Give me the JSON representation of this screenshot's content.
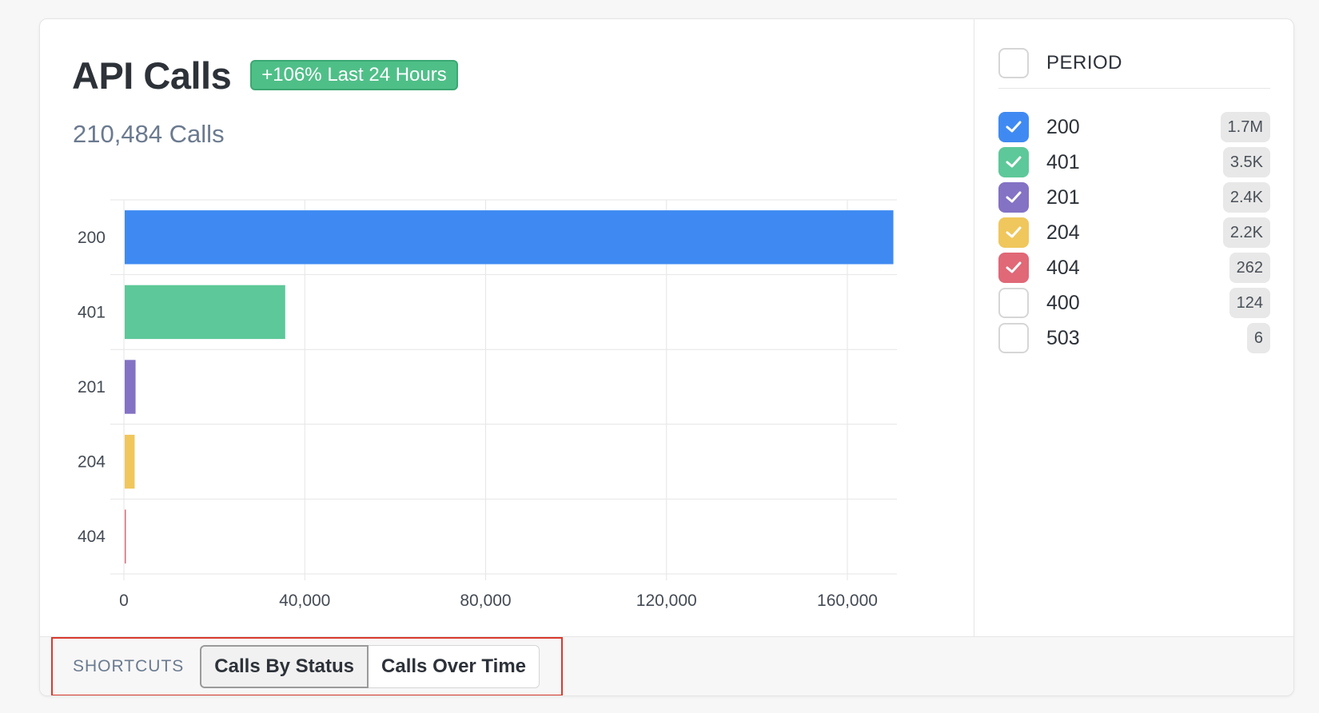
{
  "header": {
    "title": "API Calls",
    "growth_badge": "+106% Last 24 Hours",
    "subtitle": "210,484 Calls"
  },
  "chart_data": {
    "type": "bar",
    "orientation": "horizontal",
    "categories": [
      "200",
      "401",
      "201",
      "204",
      "404"
    ],
    "values": [
      170000,
      35500,
      2400,
      2200,
      262
    ],
    "colors": [
      "#3f8af2",
      "#5dc899",
      "#8472c4",
      "#f0c75d",
      "#e06877"
    ],
    "xlim": [
      0,
      180000
    ],
    "xticks": [
      0,
      40000,
      80000,
      120000,
      160000
    ],
    "xtick_labels": [
      "0",
      "40,000",
      "80,000",
      "120,000",
      "160,000"
    ],
    "grid": true,
    "title": "",
    "xlabel": "",
    "ylabel": ""
  },
  "sidebar": {
    "period_label": "PERIOD",
    "period_checked": false,
    "items": [
      {
        "code": "200",
        "count": "1.7M",
        "checked": true,
        "color": "#3f8af2"
      },
      {
        "code": "401",
        "count": "3.5K",
        "checked": true,
        "color": "#5dc899"
      },
      {
        "code": "201",
        "count": "2.4K",
        "checked": true,
        "color": "#8472c4"
      },
      {
        "code": "204",
        "count": "2.2K",
        "checked": true,
        "color": "#f0c75d"
      },
      {
        "code": "404",
        "count": "262",
        "checked": true,
        "color": "#e06877"
      },
      {
        "code": "400",
        "count": "124",
        "checked": false,
        "color": ""
      },
      {
        "code": "503",
        "count": "6",
        "checked": false,
        "color": ""
      }
    ]
  },
  "footer": {
    "shortcuts_label": "SHORTCUTS",
    "buttons": [
      {
        "label": "Calls By Status",
        "active": true
      },
      {
        "label": "Calls Over Time",
        "active": false
      }
    ]
  },
  "icons": {
    "check": "check-icon"
  }
}
